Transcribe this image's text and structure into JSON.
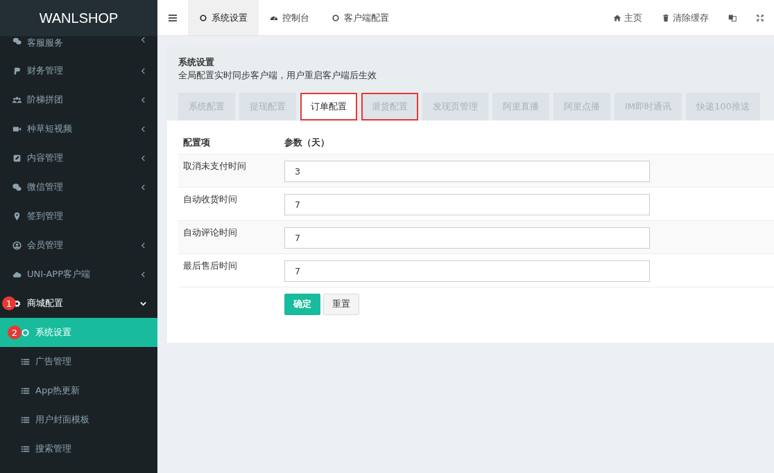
{
  "logo": "WANLSHOP",
  "sidebar": {
    "items": [
      {
        "label": "客服服务",
        "has_caret": true
      },
      {
        "label": "财务管理",
        "has_caret": true
      },
      {
        "label": "阶梯拼团",
        "has_caret": true
      },
      {
        "label": "种草短视频",
        "has_caret": true
      },
      {
        "label": "内容管理",
        "has_caret": true
      },
      {
        "label": "微信管理",
        "has_caret": true
      },
      {
        "label": "签到管理",
        "has_caret": false
      },
      {
        "label": "会员管理",
        "has_caret": true
      },
      {
        "label": "UNI-APP客户端",
        "has_caret": true
      },
      {
        "label": "商城配置",
        "has_caret": true,
        "expanded": true,
        "badge": "1",
        "children": [
          {
            "label": "系统设置",
            "selected": true,
            "badge": "2"
          },
          {
            "label": "广告管理",
            "selected": false
          },
          {
            "label": "App热更新",
            "selected": false
          },
          {
            "label": "用户封面模板",
            "selected": false
          },
          {
            "label": "搜索管理",
            "selected": false
          }
        ]
      }
    ]
  },
  "topbar": {
    "tabs": [
      {
        "label": "系统设置",
        "selected": true
      },
      {
        "label": "控制台",
        "selected": false
      },
      {
        "label": "客户端配置",
        "selected": false
      }
    ],
    "actions": [
      {
        "label": "主页"
      },
      {
        "label": "清除缓存"
      }
    ]
  },
  "panel": {
    "title": "系统设置",
    "subtitle": "全局配置实时同步客户端，用户重启客户端后生效",
    "tabs": [
      {
        "label": "系统配置",
        "selected": false,
        "highlighted": false
      },
      {
        "label": "提现配置",
        "selected": false,
        "highlighted": false
      },
      {
        "label": "订单配置",
        "selected": true,
        "highlighted": true
      },
      {
        "label": "退货配置",
        "selected": false,
        "highlighted": true
      },
      {
        "label": "发现页管理",
        "selected": false,
        "highlighted": false
      },
      {
        "label": "阿里直播",
        "selected": false,
        "highlighted": false
      },
      {
        "label": "阿里点播",
        "selected": false,
        "highlighted": false
      },
      {
        "label": "IM即时通讯",
        "selected": false,
        "highlighted": false
      },
      {
        "label": "快递100推送",
        "selected": false,
        "highlighted": false
      }
    ],
    "table": {
      "columns": [
        "配置项",
        "参数（天）"
      ],
      "rows": [
        {
          "label": "取消未支付时间",
          "value": "3"
        },
        {
          "label": "自动收货时间",
          "value": "7"
        },
        {
          "label": "自动评论时间",
          "value": "7"
        },
        {
          "label": "最后售后时间",
          "value": "7"
        }
      ]
    },
    "buttons": [
      {
        "label": "确定",
        "kind": "primary"
      },
      {
        "label": "重置",
        "kind": "default"
      }
    ]
  }
}
